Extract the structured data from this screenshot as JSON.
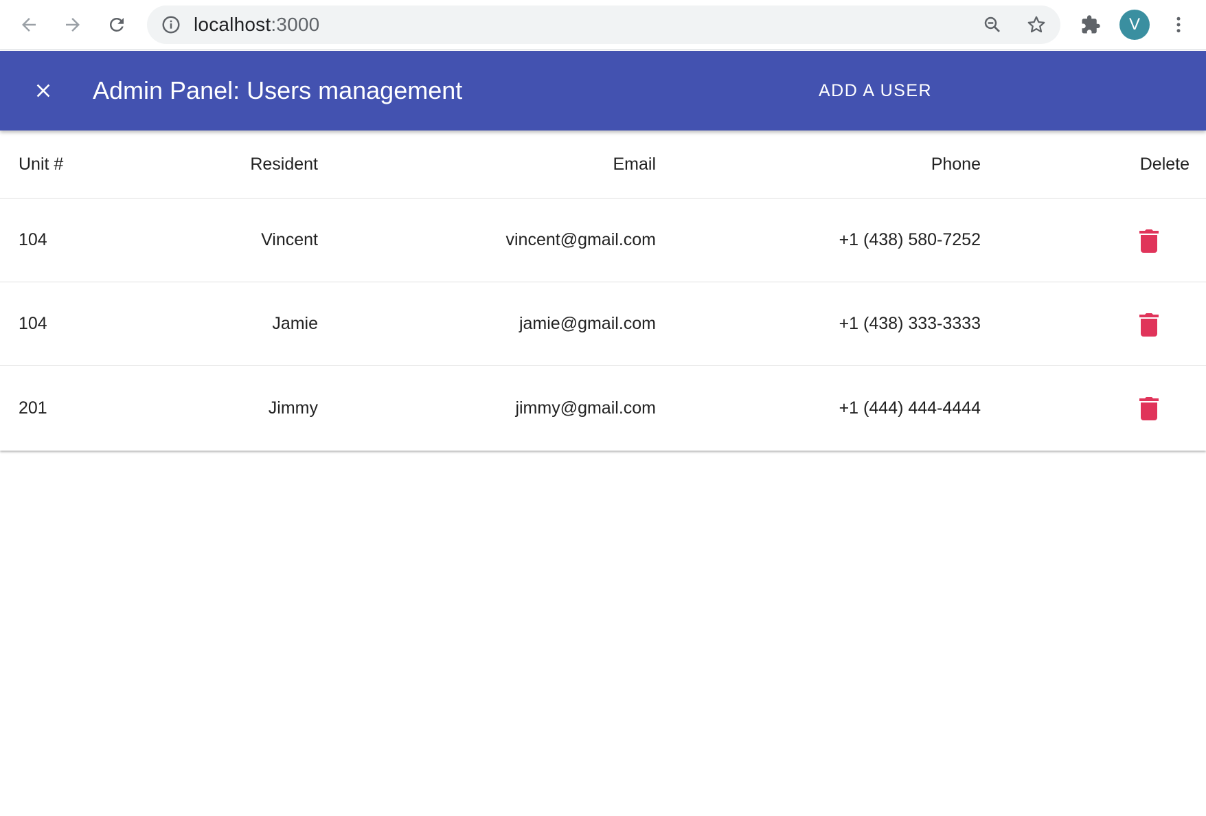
{
  "browser": {
    "url_host": "localhost",
    "url_port": ":3000",
    "profile_initial": "V",
    "icons": [
      "back-arrow-icon",
      "forward-arrow-icon",
      "reload-icon",
      "info-icon",
      "zoom-icon",
      "star-icon",
      "extensions-icon",
      "more-vert-icon"
    ]
  },
  "appbar": {
    "title": "Admin Panel: Users management",
    "add_user_label": "ADD A USER",
    "color": "#4352b0"
  },
  "table": {
    "headers": {
      "unit": "Unit #",
      "resident": "Resident",
      "email": "Email",
      "phone": "Phone",
      "delete": "Delete"
    },
    "rows": [
      {
        "unit": "104",
        "resident": "Vincent",
        "email": "vincent@gmail.com",
        "phone": "+1 (438) 580-7252"
      },
      {
        "unit": "104",
        "resident": "Jamie",
        "email": "jamie@gmail.com",
        "phone": "+1 (438) 333-3333"
      },
      {
        "unit": "201",
        "resident": "Jimmy",
        "email": "jimmy@gmail.com",
        "phone": "+1 (444) 444-4444"
      }
    ],
    "delete_icon_color": "#e0345a"
  }
}
